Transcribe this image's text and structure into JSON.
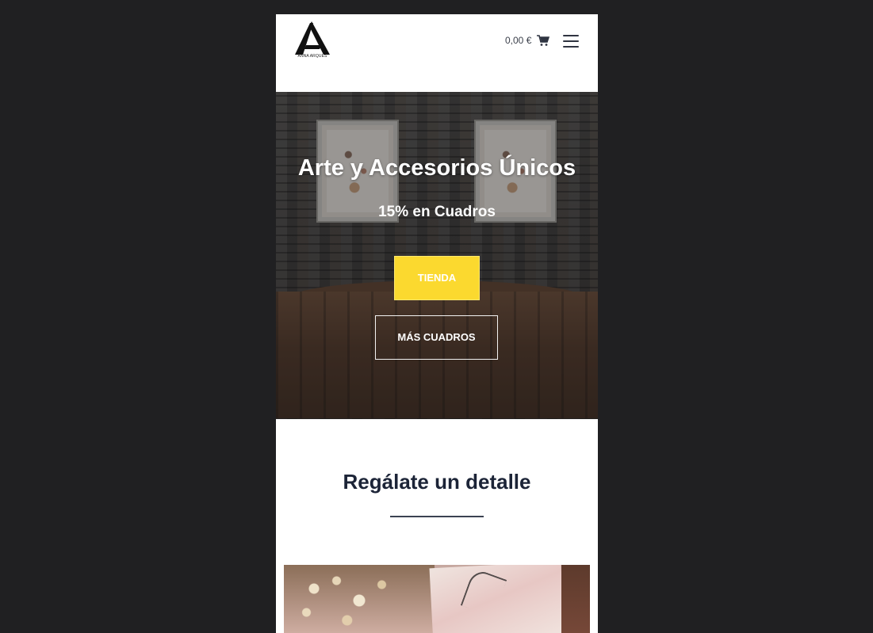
{
  "header": {
    "logo_text": "ANNA ARQUES",
    "cart_total": "0,00 €"
  },
  "hero": {
    "title": "Arte y Accesorios Únicos",
    "subtitle": "15% en Cuadros",
    "primary_button": "TIENDA",
    "secondary_button": "MÁS CUADROS"
  },
  "section": {
    "title": "Regálate un detalle"
  },
  "icons": {
    "logo": "anna-arques-logo",
    "cart": "cart-icon",
    "menu": "hamburger-menu-icon"
  },
  "colors": {
    "page_background": "#202022",
    "primary_button": "#fbd92f",
    "heading": "#1c2437"
  }
}
